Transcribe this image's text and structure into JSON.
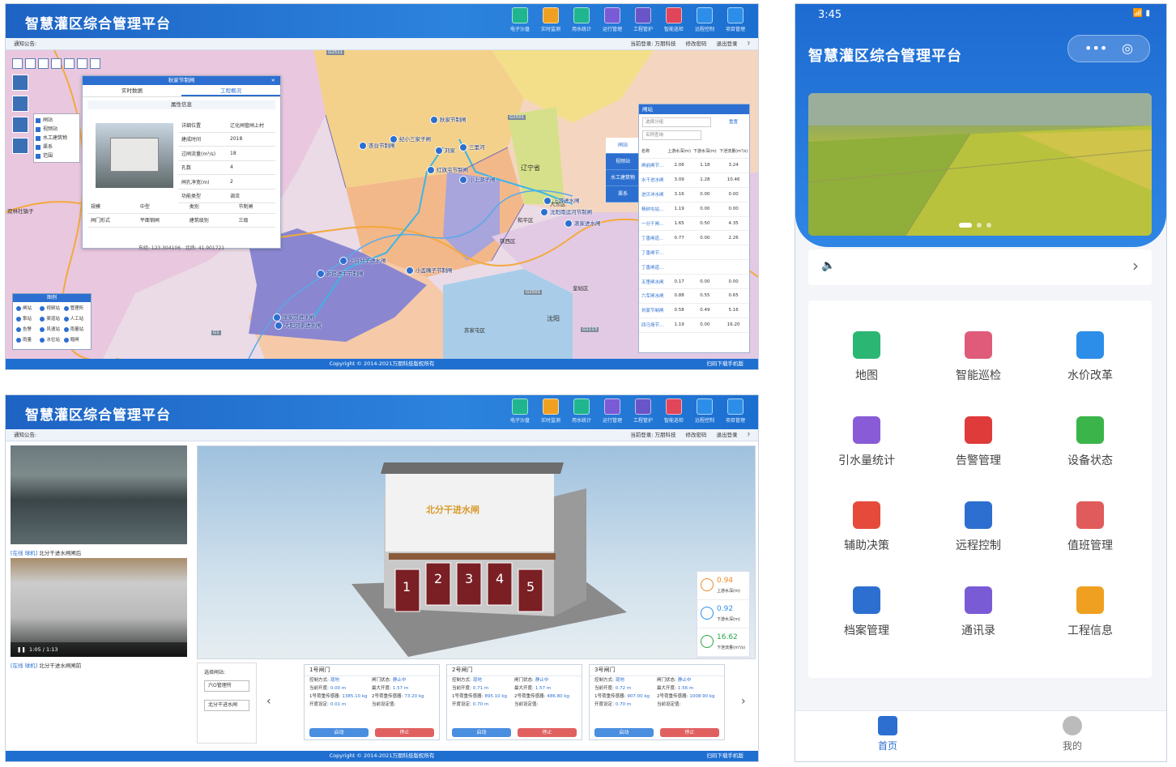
{
  "app_title": "智慧灌区综合管理平台",
  "top_nav": [
    {
      "label": "电子沙盘",
      "color": "#1fb58f"
    },
    {
      "label": "实时监测",
      "color": "#f0a020"
    },
    {
      "label": "用水统计",
      "color": "#1fb58f"
    },
    {
      "label": "运行管理",
      "color": "#7a5bd6"
    },
    {
      "label": "工程管护",
      "color": "#6a55c8"
    },
    {
      "label": "智能巡检",
      "color": "#e0455a"
    },
    {
      "label": "远程控制",
      "color": "#2c8ee8"
    },
    {
      "label": "项目管理",
      "color": "#2c8ee8"
    }
  ],
  "notice_label": "通知公告:",
  "current_user": "当前登录: 万朋科技",
  "change_password": "修改密码",
  "logout": "退出登录",
  "help": "?",
  "footer": {
    "copyright": "Copyright © 2014-2021万朋科技版权所有",
    "download": "扫码下载手机版"
  },
  "colors": {
    "primary": "#1f6fd1",
    "accent_red": "#e06060",
    "accent_blue": "#4a8ee0"
  },
  "map": {
    "layer_list": [
      "闸站",
      "视频站",
      "水工建筑物",
      "渠系",
      "范围"
    ],
    "info_popup": {
      "title": "秋家节制闸",
      "tabs": [
        "实时数据",
        "工程概况"
      ],
      "section": "属性信息",
      "attrs": [
        [
          "详细位置",
          "辽化闸管闸上村"
        ],
        [
          "建成时间",
          "2018"
        ],
        [
          "过闸流量(m³/s)",
          "18"
        ],
        [
          "孔数",
          "4"
        ],
        [
          "闸孔净宽(m)",
          "2"
        ],
        [
          "功能类型",
          "调流"
        ]
      ],
      "attrs2": [
        [
          "规模",
          "中型",
          "类别",
          "节制闸"
        ],
        [
          "闸门形式",
          "平面钢闸",
          "建筑级别",
          "三级"
        ]
      ],
      "lng": "东经: 123.304106",
      "lat": "北纬: 41.901721"
    },
    "gate_panel": {
      "title": "闸站",
      "select_placeholder": "选择分组",
      "reset": "重置",
      "search_placeholder": "名称查询",
      "side_tabs": [
        "闸站",
        "视频站",
        "水工建筑物",
        "渠系"
      ],
      "header": [
        "名称",
        "上游水深(m)",
        "下游水深(m)",
        "下泄流量(m³/s)"
      ],
      "rows": [
        [
          "闸前闸节...",
          "2.06",
          "1.18",
          "3.24"
        ],
        [
          "水干进水闸",
          "3.09",
          "1.28",
          "10.46"
        ],
        [
          "进贝冲水闸",
          "3.16",
          "0.00",
          "0.00"
        ],
        [
          "杨树屯站...",
          "1.19",
          "0.00",
          "0.00"
        ],
        [
          "一分干闸...",
          "1.65",
          "0.50",
          "4.35"
        ],
        [
          "丁香闸道...",
          "0.77",
          "0.00",
          "2.26"
        ],
        [
          "丁香闸节...",
          "",
          "",
          ""
        ],
        [
          "丁香闸道...",
          "",
          "",
          ""
        ],
        [
          "五里闸水闸",
          "0.17",
          "0.00",
          "0.00"
        ],
        [
          "六军闸水闸",
          "0.88",
          "0.55",
          "0.65"
        ],
        [
          "刘家节制闸",
          "0.58",
          "0.49",
          "5.16"
        ],
        [
          "四马场节...",
          "1.19",
          "0.00",
          "16.20"
        ]
      ]
    },
    "legend": {
      "title": "图例",
      "items": [
        "闸站",
        "视频站",
        "管理所",
        "泵站",
        "渠道站",
        "人工站",
        "告警",
        "风速站",
        "雨量站",
        "雨量",
        "水位站",
        "堰闸"
      ]
    },
    "place_labels": [
      "辽宁省",
      "沈阳",
      "苏家屯区",
      "和平区",
      "大东区",
      "铁西区",
      "双林社镇子",
      "皇姑区"
    ],
    "roads": [
      "G1501",
      "G2511",
      "G1",
      "G1113",
      "G1501"
    ],
    "stations": [
      "秋家节制闸",
      "杏台节制闸",
      "纪小三家子闸",
      "刘家",
      "三里河",
      "红旗屯节制闸",
      "小上游子闸",
      "上游进水闸",
      "滚家进水闸",
      "小孟嘴子节制闸",
      "高台节制闸",
      "新民进干节制闸",
      "上台分子进水闸",
      "沈阳南运河节制闸",
      "张家岗进水闸",
      "大阳河渠进水闸"
    ]
  },
  "remote": {
    "cameras": [
      {
        "tag": "[在线 球机]",
        "title": "北分干进水闸闸后"
      },
      {
        "tag": "[在线 球机]",
        "title": "北分干进水闸闸前"
      }
    ],
    "video_time": "1:05 / 1:13",
    "building_sign": "北分干进水闸",
    "gate_numbers": [
      "1",
      "2",
      "3",
      "4",
      "5"
    ],
    "readings": [
      {
        "value": "0.94",
        "label": "上游水深(m)",
        "color": "#f08a24"
      },
      {
        "value": "0.92",
        "label": "下游水深(m)",
        "color": "#2c8ee8"
      },
      {
        "value": "16.62",
        "label": "下泄流量(m³/s)",
        "color": "#28a745"
      }
    ],
    "select_label": "选择闸站:",
    "select_group": "六O管理所",
    "select_gate": "北分干进水闸",
    "gates": [
      {
        "name": "1号闸门",
        "mode": "现地",
        "status": "静止中",
        "open": "0.00 m",
        "max": "1.57 m",
        "rate": "1385.10 kg",
        "cap": "73.20 kg",
        "set": "0.01 m",
        "start": "启动",
        "stop": "停止"
      },
      {
        "name": "2号闸门",
        "mode": "现地",
        "status": "静止中",
        "open": "0.71 m",
        "max": "1.57 m",
        "rate": "895.10 kg",
        "cap": "486.80 kg",
        "set": "0.70 m",
        "start": "启动",
        "stop": "停止"
      },
      {
        "name": "3号闸门",
        "mode": "现地",
        "status": "静止中",
        "open": "0.72 m",
        "max": "1.56 m",
        "rate": "907.00 kg",
        "cap": "1008.90 kg",
        "set": "0.70 m",
        "start": "启动",
        "stop": "停止"
      }
    ],
    "gate_labels": {
      "mode": "控制方式:",
      "status": "闸门状态:",
      "open": "当前开度:",
      "max": "最大开度:",
      "rate": "1号荷重传感器:",
      "cap": "2号荷重传感器:",
      "set": "开度设定:",
      "unit_set": "当前设定值:"
    }
  },
  "phone": {
    "time": "3:45",
    "title": "智慧灌区综合管理平台",
    "menu": [
      {
        "label": "地图",
        "color": "#2bb673"
      },
      {
        "label": "智能巡检",
        "color": "#e05b7a"
      },
      {
        "label": "水价改革",
        "color": "#2c8ee8"
      },
      {
        "label": "引水量统计",
        "color": "#8a5bd6"
      },
      {
        "label": "告警管理",
        "color": "#e03b3b"
      },
      {
        "label": "设备状态",
        "color": "#3bb54a"
      },
      {
        "label": "辅助决策",
        "color": "#e54a3b"
      },
      {
        "label": "远程控制",
        "color": "#2c6fd0"
      },
      {
        "label": "值班管理",
        "color": "#e05b5b"
      },
      {
        "label": "档案管理",
        "color": "#2c6fd0"
      },
      {
        "label": "通讯录",
        "color": "#7a5bd6"
      },
      {
        "label": "工程信息",
        "color": "#f0a020"
      }
    ],
    "tabs": [
      {
        "label": "首页",
        "active": true
      },
      {
        "label": "我的",
        "active": false
      }
    ]
  }
}
